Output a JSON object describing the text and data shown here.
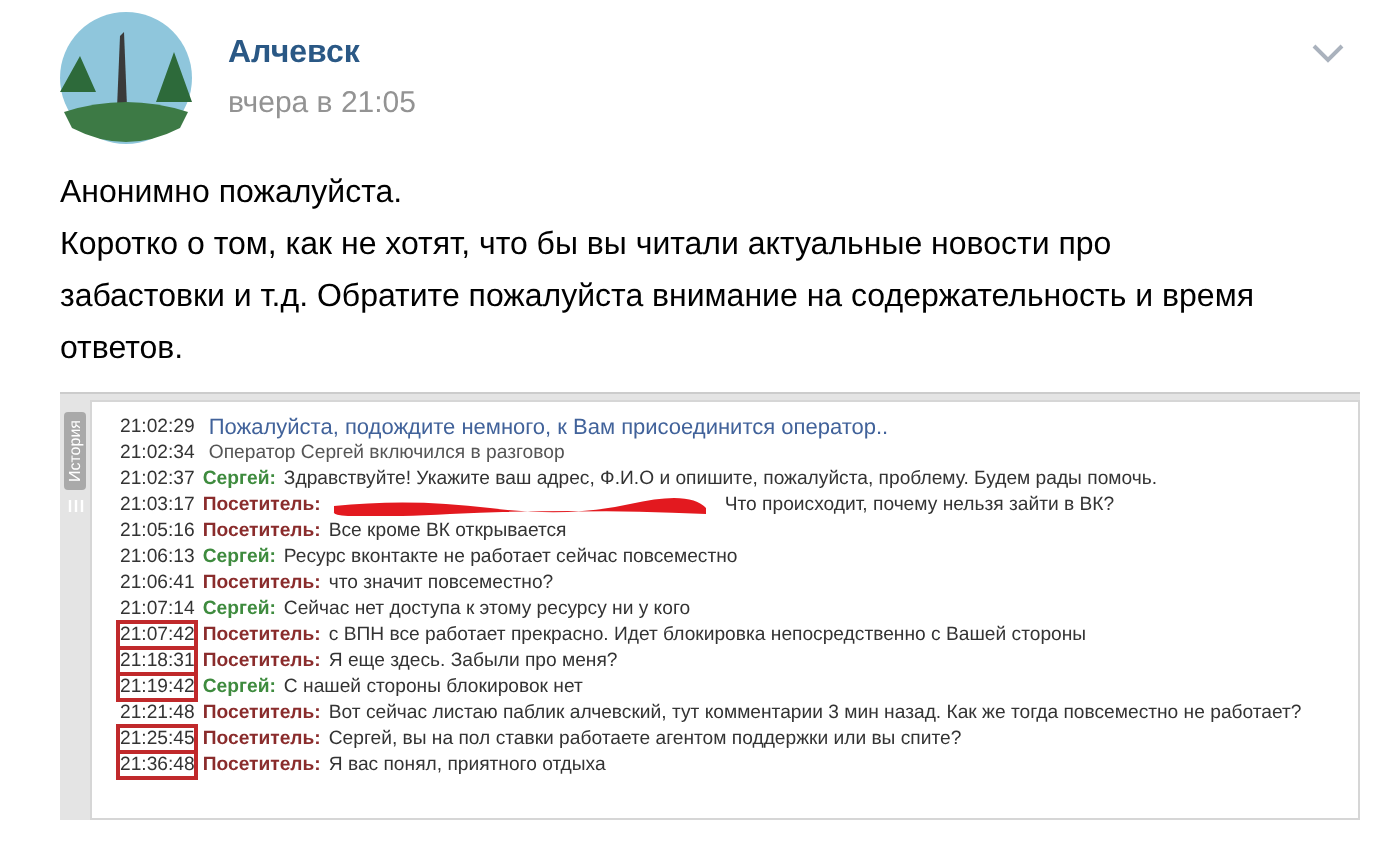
{
  "post": {
    "author": "Алчевск",
    "time": "вчера в 21:05",
    "text": [
      "Анонимно пожалуйста.",
      "Коротко о том, как не хотят, что бы вы читали актуальные новости про забастовки и т.д. Обратите пожалуйста внимание на содержательность и время ответов."
    ]
  },
  "chat": {
    "side_tab": "История",
    "messages": [
      {
        "kind": "system",
        "time": "21:02:29",
        "text": "Пожалуйста, подождите немного, к Вам присоединится оператор..",
        "highlighted": false
      },
      {
        "kind": "info",
        "time": "21:02:34",
        "text": "Оператор Сергей включился в разговор",
        "highlighted": false
      },
      {
        "kind": "operator",
        "time": "21:02:37",
        "sender": "Сергей:",
        "text": "Здравствуйте! Укажите ваш адрес, Ф.И.О и опишите, пожалуйста, проблему. Будем рады помочь.",
        "highlighted": false
      },
      {
        "kind": "visitor",
        "time": "21:03:17",
        "sender": "Посетитель:",
        "text": "Что происходит, почему нельзя зайти в ВК?",
        "redacted": true,
        "highlighted": false
      },
      {
        "kind": "visitor",
        "time": "21:05:16",
        "sender": "Посетитель:",
        "text": "Все кроме ВК открывается",
        "highlighted": false
      },
      {
        "kind": "operator",
        "time": "21:06:13",
        "sender": "Сергей:",
        "text": "Ресурс вконтакте не работает сейчас повсеместно",
        "highlighted": false
      },
      {
        "kind": "visitor",
        "time": "21:06:41",
        "sender": "Посетитель:",
        "text": "что значит повсеместно?",
        "highlighted": false
      },
      {
        "kind": "operator",
        "time": "21:07:14",
        "sender": "Сергей:",
        "text": "Сейчас нет доступа к этому ресурсу ни у кого",
        "highlighted": false
      },
      {
        "kind": "visitor",
        "time": "21:07:42",
        "sender": "Посетитель:",
        "text": "с ВПН все работает прекрасно. Идет блокировка непосредственно с Вашей стороны",
        "highlighted": true
      },
      {
        "kind": "visitor",
        "time": "21:18:31",
        "sender": "Посетитель:",
        "text": "Я еще здесь. Забыли про меня?",
        "highlighted": true
      },
      {
        "kind": "operator",
        "time": "21:19:42",
        "sender": "Сергей:",
        "text": "С нашей стороны блокировок нет",
        "highlighted": true
      },
      {
        "kind": "visitor",
        "time": "21:21:48",
        "sender": "Посетитель:",
        "text": "Вот сейчас листаю паблик алчевский, тут комментарии 3 мин назад. Как же тогда повсеместно не работает?",
        "highlighted": false
      },
      {
        "kind": "visitor",
        "time": "21:25:45",
        "sender": "Посетитель:",
        "text": "Сергей, вы на пол ставки работаете агентом поддержки или вы спите?",
        "highlighted": true
      },
      {
        "kind": "visitor",
        "time": "21:36:48",
        "sender": "Посетитель:",
        "text": "Я вас понял, приятного отдыха",
        "highlighted": true
      }
    ]
  }
}
